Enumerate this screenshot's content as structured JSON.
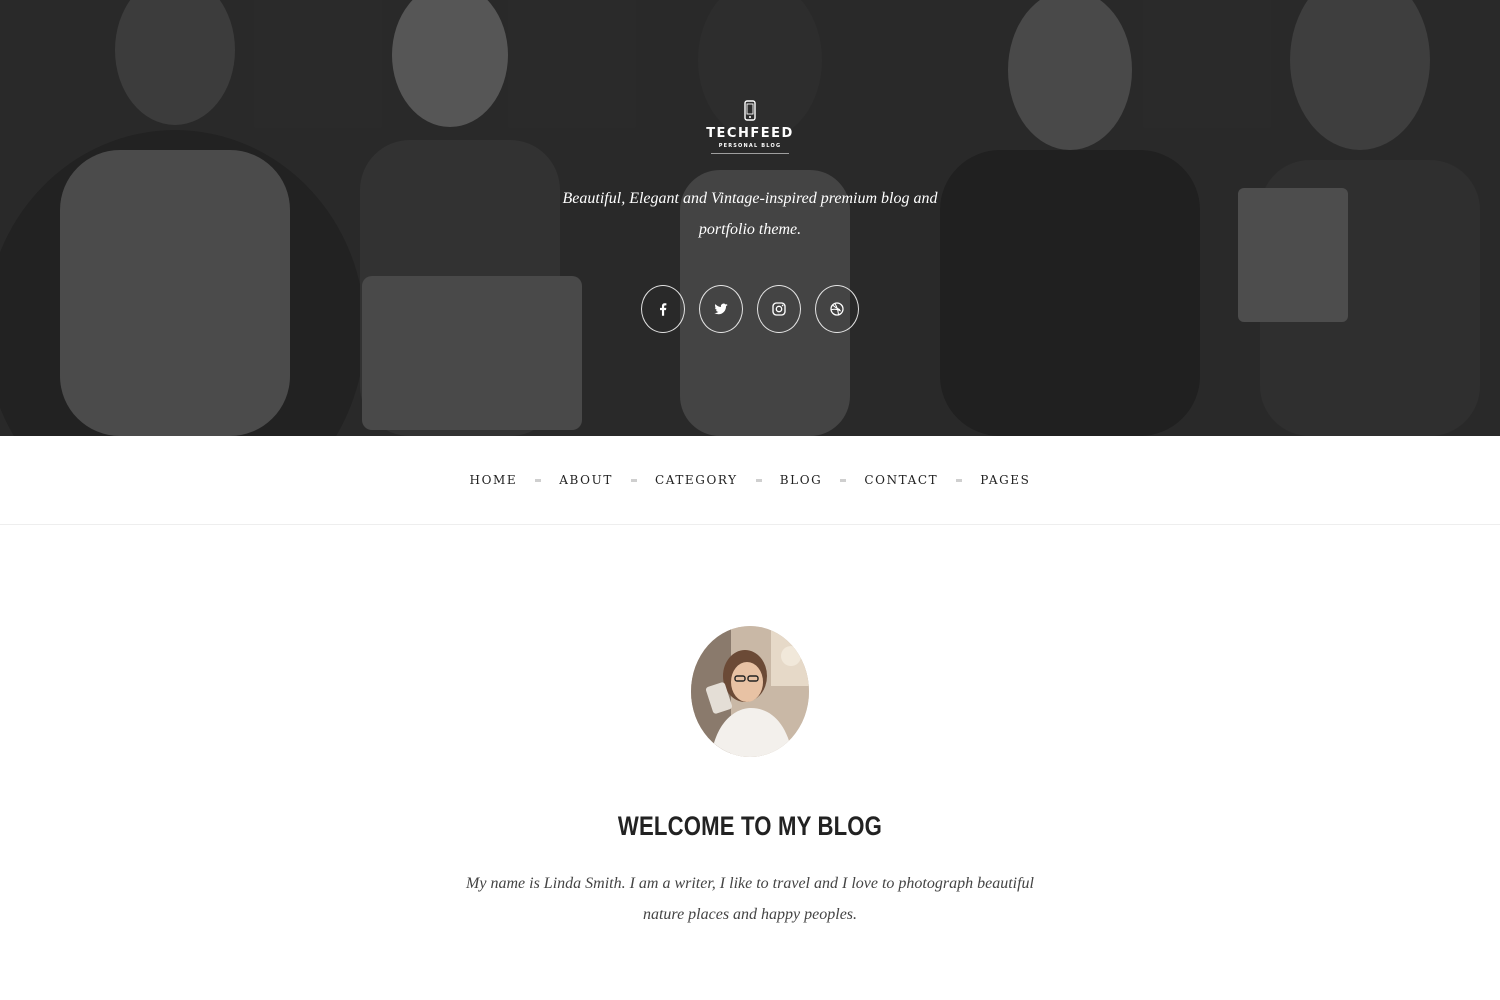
{
  "hero": {
    "logo": {
      "title": "TECHFEED",
      "subtitle": "PERSONAL BLOG",
      "icon": "phone-icon"
    },
    "tagline": "Beautiful, Elegant and Vintage-inspired premium blog and portfolio theme.",
    "social": [
      {
        "name": "facebook",
        "icon": "facebook-icon"
      },
      {
        "name": "twitter",
        "icon": "twitter-icon"
      },
      {
        "name": "instagram",
        "icon": "instagram-icon"
      },
      {
        "name": "dribbble",
        "icon": "dribbble-icon"
      }
    ]
  },
  "nav": {
    "items": [
      {
        "label": "HOME"
      },
      {
        "label": "ABOUT"
      },
      {
        "label": "CATEGORY"
      },
      {
        "label": "BLOG"
      },
      {
        "label": "CONTACT"
      },
      {
        "label": "PAGES"
      }
    ]
  },
  "profile": {
    "heading": "WELCOME TO MY BLOG",
    "bio": "My name is Linda Smith. I am a writer, I like to travel and I love to photograph beautiful nature places and happy peoples."
  },
  "colors": {
    "hero_bg": "#2b2b2b",
    "text_dark": "#222222",
    "nav_separator": "#cfcfcf",
    "white": "#ffffff"
  }
}
